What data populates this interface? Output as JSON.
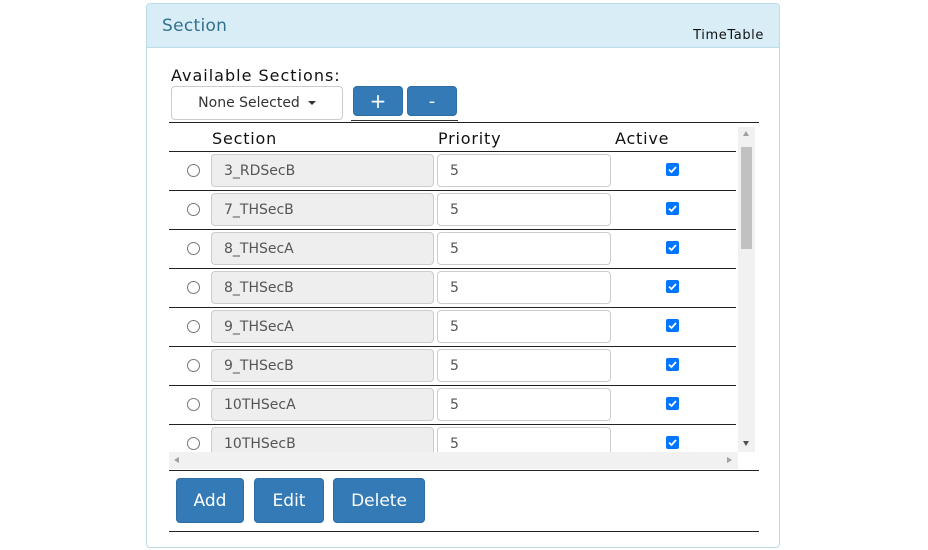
{
  "panel": {
    "title": "Section",
    "right_label": "TimeTable"
  },
  "available": {
    "label": "Available Sections:",
    "dropdown_value": "None Selected",
    "plus_label": "+",
    "minus_label": "-"
  },
  "table": {
    "headers": {
      "section": "Section",
      "priority": "Priority",
      "active": "Active"
    },
    "rows": [
      {
        "section": "3_RDSecB",
        "priority": "5",
        "active": true
      },
      {
        "section": "7_THSecB",
        "priority": "5",
        "active": true
      },
      {
        "section": "8_THSecA",
        "priority": "5",
        "active": true
      },
      {
        "section": "8_THSecB",
        "priority": "5",
        "active": true
      },
      {
        "section": "9_THSecA",
        "priority": "5",
        "active": true
      },
      {
        "section": "9_THSecB",
        "priority": "5",
        "active": true
      },
      {
        "section": "10THSecA",
        "priority": "5",
        "active": true
      },
      {
        "section": "10THSecB",
        "priority": "5",
        "active": true
      }
    ]
  },
  "actions": {
    "add": "Add",
    "edit": "Edit",
    "delete": "Delete"
  },
  "colors": {
    "header_bg": "#d9edf7",
    "title_color": "#31708f",
    "primary_button": "#337ab7",
    "readonly_input_bg": "#eeeeee",
    "checkbox": "#0075ff"
  }
}
